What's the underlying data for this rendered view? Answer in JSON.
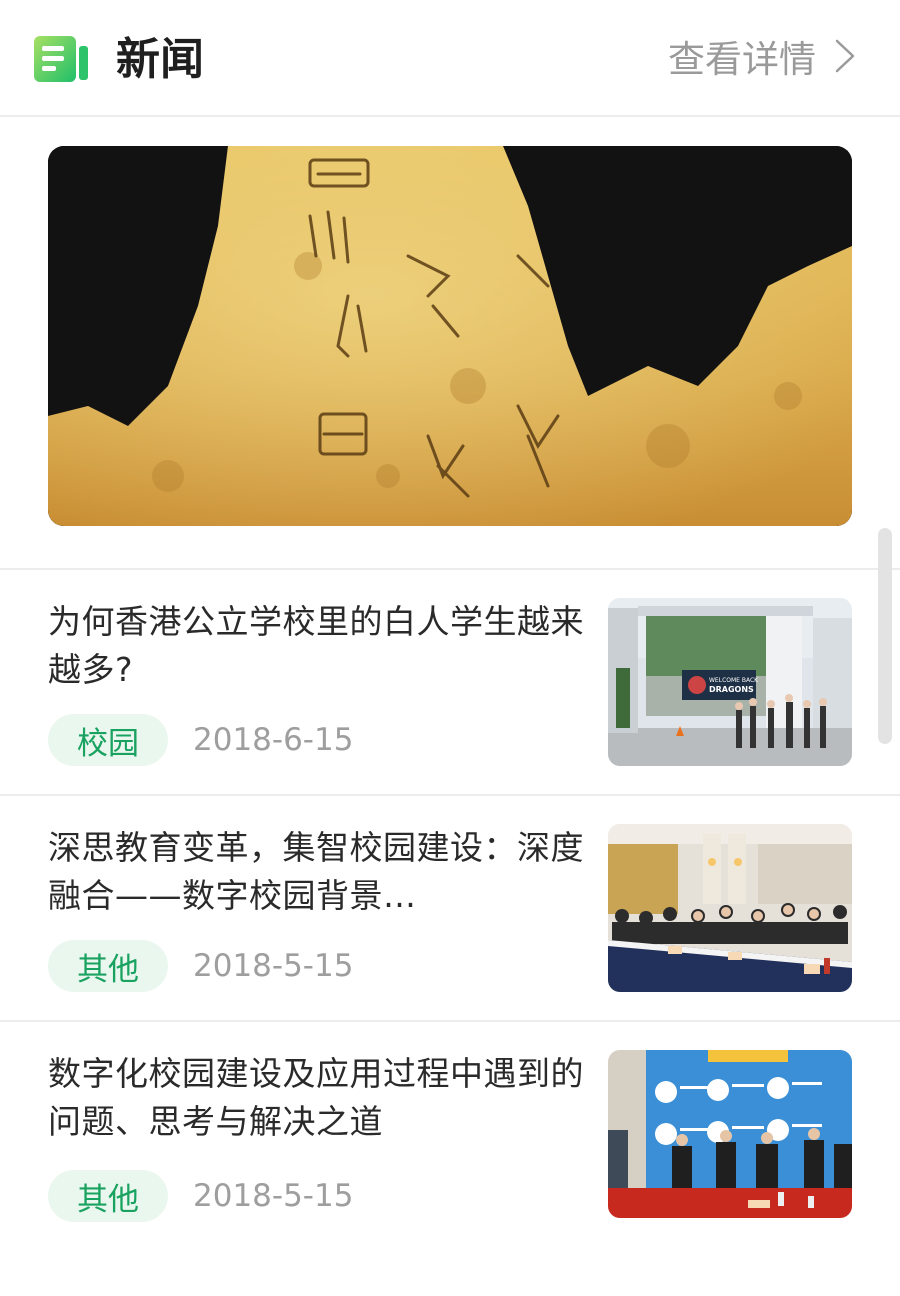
{
  "header": {
    "title": "新闻",
    "more_label": "查看详情",
    "logo_icon": "news-book-icon",
    "chevron_icon": "chevron-right-icon"
  },
  "news": [
    {
      "title": "为何香港公立学校里的白人学生越来越多?",
      "tag": "校园",
      "date": "2018-6-15",
      "thumb_text": {
        "line1": "WELCOME BACK",
        "line2": "DRAGONS"
      }
    },
    {
      "title": "深思教育变革，集智校园建设：深度融合——数字校园背景…",
      "tag": "其他",
      "date": "2018-5-15"
    },
    {
      "title": "数字化校园建设及应用过程中遇到的问题、思考与解决之道",
      "tag": "其他",
      "date": "2018-5-15"
    }
  ],
  "colors": {
    "accent": "#1aa260",
    "tag_bg": "#e9f7ef",
    "muted": "#9e9e9e"
  }
}
